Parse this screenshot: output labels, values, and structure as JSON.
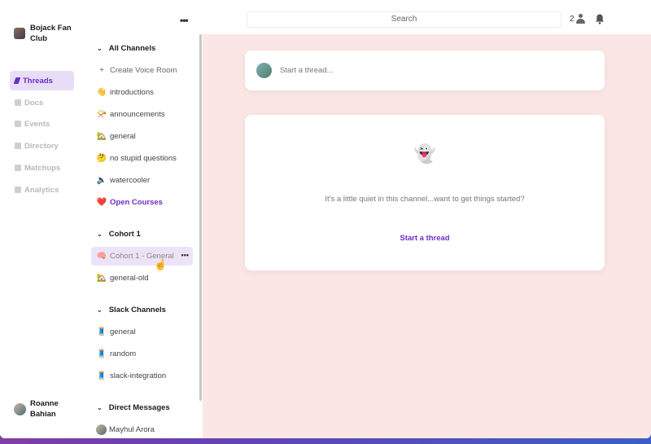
{
  "topbar": {
    "search_placeholder": "Search",
    "member_count": "2"
  },
  "org": {
    "name": "Bojack Fan Club"
  },
  "nav": {
    "items": [
      {
        "label": "Threads",
        "icon": "pencil-icon"
      },
      {
        "label": "Docs",
        "icon": "doc-icon"
      },
      {
        "label": "Events",
        "icon": "calendar-icon"
      },
      {
        "label": "Directory",
        "icon": "directory-icon"
      },
      {
        "label": "Matchups",
        "icon": "matchups-icon"
      },
      {
        "label": "Analytics",
        "icon": "analytics-icon"
      }
    ]
  },
  "user": {
    "name": "Roanne Bahian"
  },
  "channels": {
    "all": {
      "title": "All Channels",
      "create_voice": "Create Voice Room",
      "items": [
        {
          "emoji": "👋",
          "label": "introductions"
        },
        {
          "emoji": "📯",
          "label": "announcements"
        },
        {
          "emoji": "🏡",
          "label": "general"
        },
        {
          "emoji": "🤔",
          "label": "no stupid questions"
        },
        {
          "emoji": "🔈",
          "label": "watercooler"
        },
        {
          "emoji": "❤️",
          "label": "Open Courses"
        }
      ]
    },
    "cohort": {
      "title": "Cohort 1",
      "items": [
        {
          "emoji": "🧠",
          "label": "Cohort 1 - General"
        },
        {
          "emoji": "🏡",
          "label": "general-old"
        }
      ]
    },
    "slack": {
      "title": "Slack Channels",
      "items": [
        {
          "emoji": "🧵",
          "label": "general"
        },
        {
          "emoji": "🧵",
          "label": "random"
        },
        {
          "emoji": "🧵",
          "label": "slack-integration"
        }
      ]
    },
    "dms": {
      "title": "Direct Messages",
      "items": [
        {
          "label": "Mayhul Arora"
        }
      ]
    }
  },
  "main": {
    "composer_placeholder": "Start a thread...",
    "empty_emoji": "👻",
    "empty_text": "It's a little quiet in this channel...want to get things started?",
    "start_link": "Start a thread"
  }
}
